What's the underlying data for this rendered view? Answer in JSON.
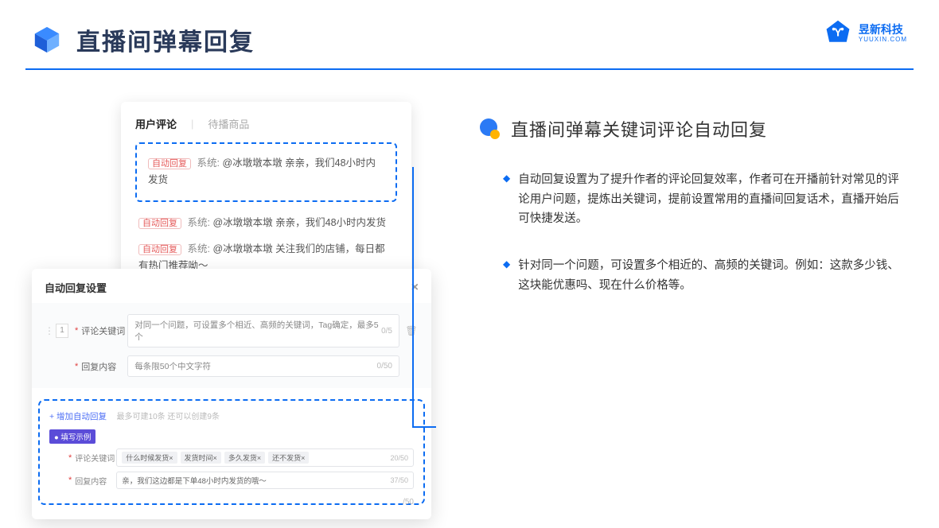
{
  "header": {
    "title": "直播间弹幕回复"
  },
  "brand": {
    "name_cn": "昱新科技",
    "name_en": "YUUXIN.COM"
  },
  "comments_panel": {
    "tab_active": "用户评论",
    "tab_inactive": "待播商品",
    "badge": "自动回复",
    "system_label": "系统:",
    "row1": "@冰墩墩本墩 亲亲，我们48小时内发货",
    "row2": "@冰墩墩本墩 亲亲，我们48小时内发货",
    "row3": "@冰墩墩本墩 关注我们的店铺，每日都有热门推荐呦～"
  },
  "settings_panel": {
    "title": "自动回复设置",
    "row_number": "1",
    "label_keyword": "评论关键词",
    "keyword_placeholder": "对同一个问题，可设置多个相近、高频的关键词，Tag确定，最多5个",
    "keyword_counter": "0/5",
    "label_content": "回复内容",
    "content_placeholder": "每条限50个中文字符",
    "content_counter": "0/50",
    "add_link": "+ 增加自动回复",
    "add_hint": "最多可建10条 还可以创建9条",
    "example_tag": "● 填写示例",
    "ex_label_keyword": "评论关键词",
    "chips": [
      "什么时候发货×",
      "发货时间×",
      "多久发货×",
      "还不发货×"
    ],
    "ex_keyword_counter": "20/50",
    "ex_label_content": "回复内容",
    "ex_content_value": "亲，我们这边都是下单48小时内发货的哦～",
    "ex_content_counter": "37/50",
    "footer_counter": "/50"
  },
  "right": {
    "section_title": "直播间弹幕关键词评论自动回复",
    "bullet1": "自动回复设置为了提升作者的评论回复效率，作者可在开播前针对常见的评论用户问题，提炼出关键词，提前设置常用的直播间回复话术，直播开始后可快捷发送。",
    "bullet2": "针对同一个问题，可设置多个相近的、高频的关键词。例如：这款多少钱、这块能优惠吗、现在什么价格等。"
  }
}
